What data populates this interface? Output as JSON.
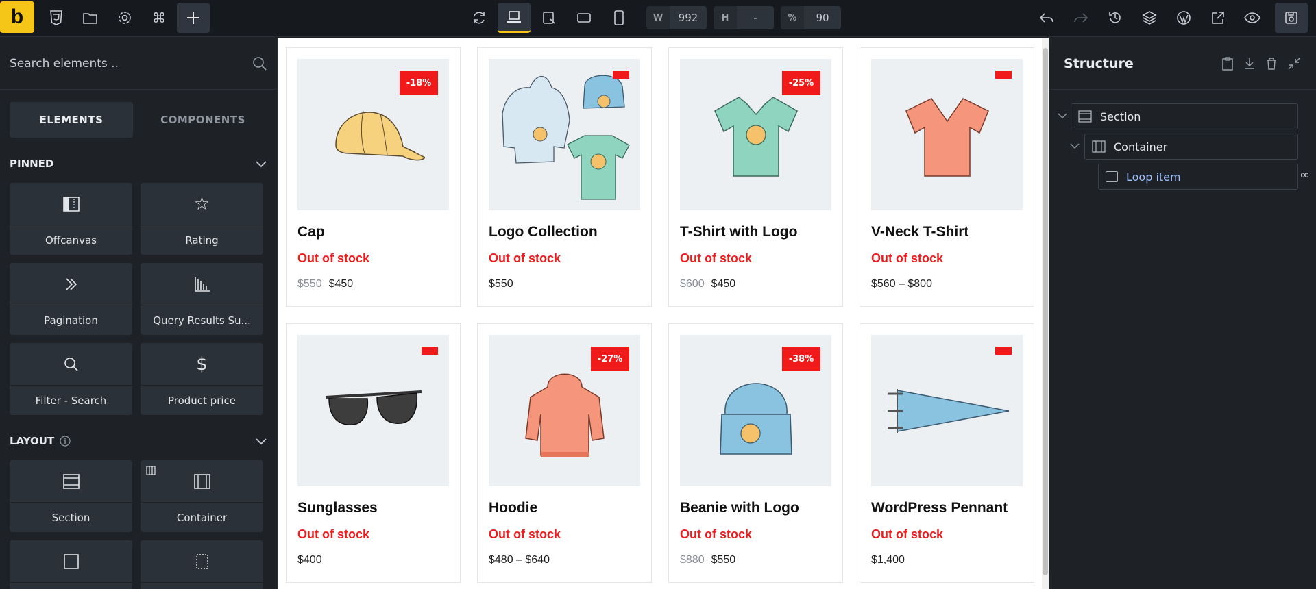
{
  "toolbar": {
    "logo": "b",
    "width_key": "W",
    "width_value": "992",
    "height_key": "H",
    "height_value": "-",
    "scale_key": "%",
    "scale_value": "90"
  },
  "sidebar": {
    "search_placeholder": "Search elements ..",
    "tab_elements": "ELEMENTS",
    "tab_components": "COMPONENTS",
    "pinned_title": "PINNED",
    "pinned": [
      {
        "label": "Offcanvas"
      },
      {
        "label": "Rating"
      },
      {
        "label": "Pagination"
      },
      {
        "label": "Query Results Su..."
      },
      {
        "label": "Filter - Search"
      },
      {
        "label": "Product price"
      }
    ],
    "layout_title": "LAYOUT",
    "layout": [
      {
        "label": "Section"
      },
      {
        "label": "Container"
      }
    ]
  },
  "products": [
    {
      "name": "Cap",
      "stock": "Out of stock",
      "old_price": "$550",
      "price": "$450",
      "badge": "-18%"
    },
    {
      "name": "Logo Collection",
      "stock": "Out of stock",
      "old_price": "",
      "price": "$550",
      "badge": ""
    },
    {
      "name": "T-Shirt with Logo",
      "stock": "Out of stock",
      "old_price": "$600",
      "price": "$450",
      "badge": "-25%"
    },
    {
      "name": "V-Neck T-Shirt",
      "stock": "Out of stock",
      "old_price": "",
      "price": "$560 – $800",
      "badge": ""
    },
    {
      "name": "Sunglasses",
      "stock": "Out of stock",
      "old_price": "",
      "price": "$400",
      "badge": ""
    },
    {
      "name": "Hoodie",
      "stock": "Out of stock",
      "old_price": "",
      "price": "$480 – $640",
      "badge": "-27%"
    },
    {
      "name": "Beanie with Logo",
      "stock": "Out of stock",
      "old_price": "$880",
      "price": "$550",
      "badge": "-38%"
    },
    {
      "name": "WordPress Pennant",
      "stock": "Out of stock",
      "old_price": "",
      "price": "$1,400",
      "badge": ""
    }
  ],
  "structure": {
    "title": "Structure",
    "nodes": [
      {
        "label": "Section"
      },
      {
        "label": "Container"
      },
      {
        "label": "Loop item"
      }
    ]
  },
  "colors": {
    "accent": "#f5c518",
    "sale": "#f01a1a",
    "link": "#9fc2ff"
  }
}
